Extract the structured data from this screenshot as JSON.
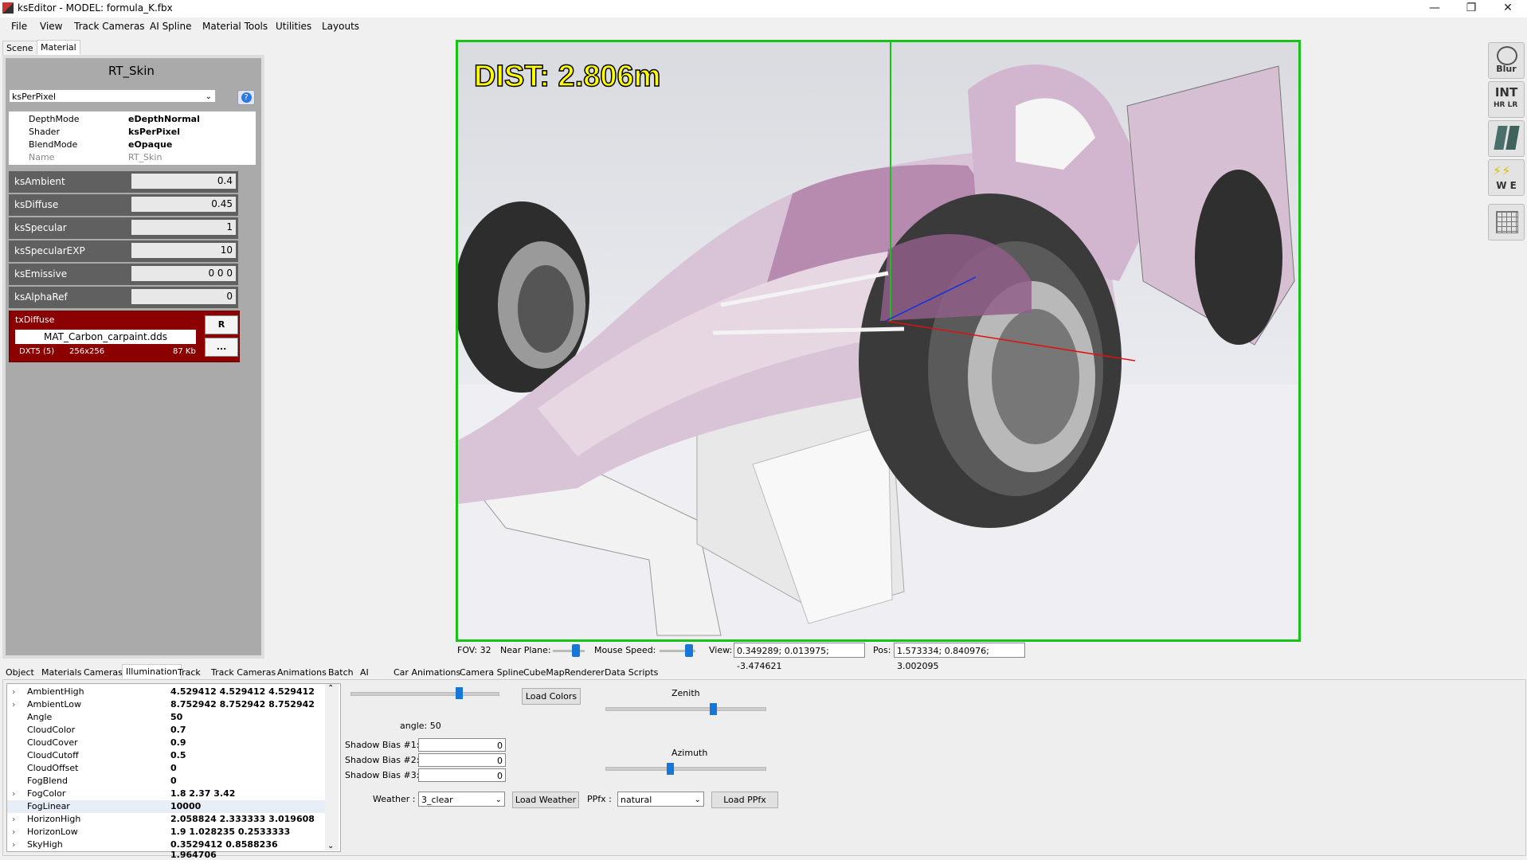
{
  "window": {
    "title": "ksEditor - MODEL: formula_K.fbx",
    "minimize": "—",
    "restore": "❐",
    "close": "✕"
  },
  "menu": [
    "File",
    "View",
    "Track Cameras",
    "AI Spline",
    "Material Tools",
    "Utilities",
    "Layouts"
  ],
  "left_tabs": [
    "Scene",
    "Material"
  ],
  "material": {
    "name": "RT_Skin",
    "shader_select": "ksPerPixel",
    "properties": [
      {
        "key": "DepthMode",
        "value": "eDepthNormal"
      },
      {
        "key": "Shader",
        "value": "ksPerPixel"
      },
      {
        "key": "BlendMode",
        "value": "eOpaque"
      },
      {
        "key": "Name",
        "value": "RT_Skin"
      }
    ],
    "params": [
      {
        "label": "ksAmbient",
        "value": "0.4"
      },
      {
        "label": "ksDiffuse",
        "value": "0.45"
      },
      {
        "label": "ksSpecular",
        "value": "1"
      },
      {
        "label": "ksSpecularEXP",
        "value": "10"
      },
      {
        "label": "ksEmissive",
        "value": "0 0 0"
      },
      {
        "label": "ksAlphaRef",
        "value": "0"
      }
    ],
    "texture": {
      "slot": "txDiffuse",
      "file": "MAT_Carbon_carpaint.dds",
      "format": "DXT5 (5)",
      "size": "256x256",
      "kb": "87 Kb",
      "r_button": "R",
      "browse_button": "..."
    }
  },
  "viewport": {
    "dist": "DIST: 2.806m"
  },
  "toolbar": [
    {
      "name": "blur",
      "label": "Blur"
    },
    {
      "name": "int",
      "label": "INT"
    },
    {
      "name": "tyres",
      "label": ""
    },
    {
      "name": "we",
      "label": "W E"
    },
    {
      "name": "grid",
      "label": ""
    }
  ],
  "view_status": {
    "fov": "FOV: 32",
    "near_plane": "Near Plane:",
    "mouse_speed": "Mouse Speed:",
    "view_label": "View:",
    "view_value": "0.349289; 0.013975; -3.474621",
    "pos_label": "Pos:",
    "pos_value": "1.573334; 0.840976; 3.002095"
  },
  "bottom_tabs": [
    "Object",
    "Materials",
    "Cameras",
    "Illumination",
    "Track",
    "Track Cameras",
    "Animations",
    "Batch",
    "AI",
    "Car Animations",
    "Camera Spline",
    "CubeMapRenderer",
    "Data Scripts"
  ],
  "illumination": {
    "rows": [
      {
        "expand": "›",
        "key": "AmbientHigh",
        "value": "4.529412 4.529412 4.529412"
      },
      {
        "expand": "›",
        "key": "AmbientLow",
        "value": "8.752942 8.752942 8.752942"
      },
      {
        "expand": "",
        "key": "Angle",
        "value": "50"
      },
      {
        "expand": "",
        "key": "CloudColor",
        "value": "0.7"
      },
      {
        "expand": "",
        "key": "CloudCover",
        "value": "0.9"
      },
      {
        "expand": "",
        "key": "CloudCutoff",
        "value": "0.5"
      },
      {
        "expand": "",
        "key": "CloudOffset",
        "value": "0"
      },
      {
        "expand": "",
        "key": "FogBlend",
        "value": "0"
      },
      {
        "expand": "›",
        "key": "FogColor",
        "value": "1.8 2.37 3.42"
      },
      {
        "expand": "",
        "key": "FogLinear",
        "value": "10000"
      },
      {
        "expand": "›",
        "key": "HorizonHigh",
        "value": "2.058824 2.333333 3.019608"
      },
      {
        "expand": "›",
        "key": "HorizonLow",
        "value": "1.9 1.028235 0.2533333"
      },
      {
        "expand": "›",
        "key": "SkyHigh",
        "value": "0.3529412 0.8588236 1.964706"
      }
    ],
    "load_colors": "Load Colors",
    "angle_label": "angle: 50",
    "shadow_bias": [
      {
        "label": "Shadow Bias #1:",
        "value": "0"
      },
      {
        "label": "Shadow Bias #2:",
        "value": "0"
      },
      {
        "label": "Shadow Bias #3:",
        "value": "0"
      }
    ],
    "weather_label": "Weather :",
    "weather_value": "3_clear",
    "load_weather": "Load Weather",
    "ppfx_label": "PPfx :",
    "ppfx_value": "natural",
    "load_ppfx": "Load PPfx",
    "zenith_label": "Zenith",
    "azimuth_label": "Azimuth"
  }
}
